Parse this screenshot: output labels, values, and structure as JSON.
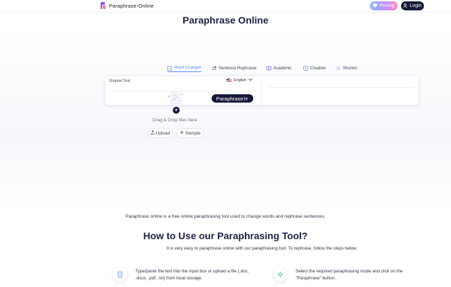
{
  "navbar": {
    "brand": "Paraphrase-Online",
    "pricing": "Pricing",
    "login": "Login"
  },
  "hero": {
    "title": "Paraphrase Online"
  },
  "tabs": [
    {
      "label": "Word Changer",
      "icon": "word-changer-icon",
      "active": true
    },
    {
      "label": "Sentence Rephraser",
      "icon": "sentence-rephraser-icon",
      "active": false
    },
    {
      "label": "Academic",
      "icon": "academic-icon",
      "active": false
    },
    {
      "label": "Creative",
      "icon": "creative-icon",
      "active": false
    },
    {
      "label": "Shorten",
      "icon": "shorten-icon",
      "active": false
    }
  ],
  "editor": {
    "original_label": "Original Text",
    "language": "English",
    "paraphrase_button": "Paraphrase",
    "drop_text": "Drag & Drop files here",
    "upload": "Upload",
    "sample": "Sample"
  },
  "about": "Paraphrase online is a free online paraphrasing tool used to change words and rephrase sentences.",
  "howto": {
    "title": "How to Use our Paraphrasing Tool?",
    "description": "It is very easy to paraphrase online with our paraphrasing tool. To rephrase, follow the steps below.",
    "steps": [
      {
        "text": "Type/paste the text into the input box or upload a file (.doc, .docx, .pdf, .txt) from local storage.",
        "icon": "document-icon"
      },
      {
        "text": "Select the required paraphrasing mode and click on the \"Paraphrase\" button.",
        "icon": "settings-sparkle-icon"
      }
    ]
  },
  "colors": {
    "accent": "#5b8df6",
    "dark": "#151a3a"
  }
}
